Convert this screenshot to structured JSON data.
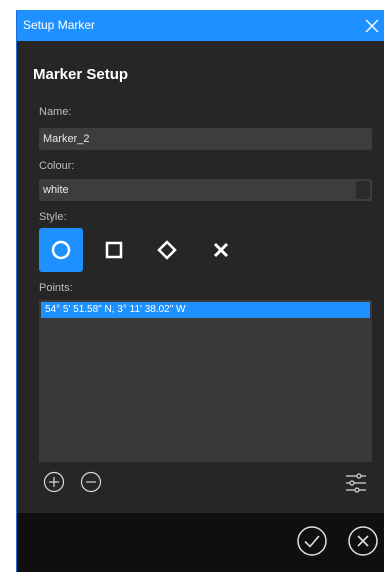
{
  "window": {
    "title": "Setup Marker"
  },
  "heading": "Marker Setup",
  "name": {
    "label": "Name:",
    "value": "Marker_2"
  },
  "colour": {
    "label": "Colour:",
    "value": "white"
  },
  "style": {
    "label": "Style:",
    "options": [
      "circle",
      "square",
      "diamond",
      "cross"
    ],
    "selected": "circle"
  },
  "points": {
    "label": "Points:",
    "items": [
      "54° 5' 51.58\" N, 3° 11' 38.02\" W"
    ]
  },
  "colors": {
    "accent": "#1e90ff",
    "panel": "#262626",
    "field": "#3d3d3d",
    "footer": "#0f0f0f"
  },
  "icons": {
    "close": "close-icon",
    "add": "plus-circle-icon",
    "remove": "minus-circle-icon",
    "settings": "sliders-icon",
    "ok": "check-circle-icon",
    "cancel": "x-circle-icon"
  }
}
